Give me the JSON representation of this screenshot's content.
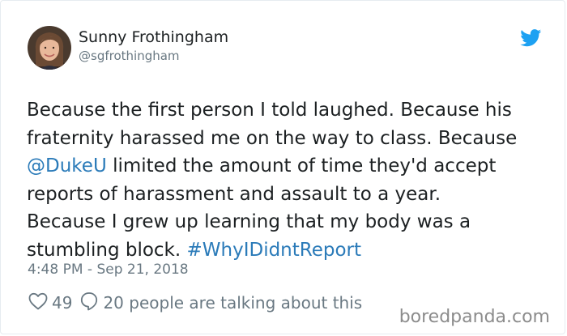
{
  "author": {
    "name": "Sunny Frothingham",
    "handle": "@sgfrothingham",
    "avatar_icon": "user-avatar-photo"
  },
  "brand": {
    "icon": "twitter-bird-icon",
    "color": "#1da1f2"
  },
  "tweet": {
    "line1": "Because the first person I told laughed. Because his",
    "line2": "fraternity harassed me on the way to class. Because",
    "mention": "@DukeU",
    "line3_rest": " limited the amount of time they'd accept",
    "line4": "reports of harassment and assault to a year.",
    "line5": "Because I grew up learning that my body was a",
    "line6_start": "stumbling block. ",
    "hashtag": "#WhyIDidntReport",
    "link_color": "#2b7bb9"
  },
  "meta": {
    "timestamp": "4:48 PM - Sep 21, 2018"
  },
  "actions": {
    "likes": "49",
    "like_icon": "heart-icon",
    "reply_icon": "speech-bubble-icon",
    "talking": "20 people are talking about this"
  },
  "watermark": {
    "text": "boredpanda.com"
  }
}
